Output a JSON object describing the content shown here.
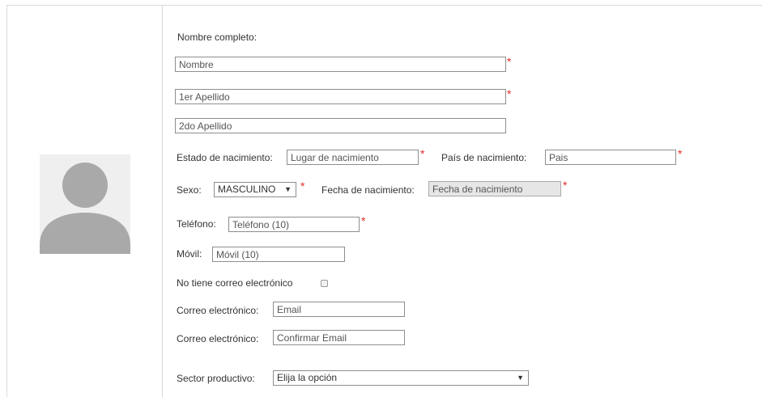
{
  "form": {
    "full_name_label": "Nombre completo:",
    "nombre_placeholder": "Nombre",
    "apellido1_placeholder": "1er Apellido",
    "apellido2_placeholder": "2do Apellido",
    "estado_label": "Estado de nacimiento:",
    "estado_placeholder": "Lugar de nacimiento",
    "pais_label": "País de nacimiento:",
    "pais_placeholder": "Pais",
    "sexo_label": "Sexo:",
    "sexo_value": "MASCULINO",
    "fecha_label": "Fecha de nacimiento:",
    "fecha_placeholder": "Fecha de nacimiento",
    "telefono_label": "Teléfono:",
    "telefono_placeholder": "Teléfono (10)",
    "movil_label": "Móvil:",
    "movil_placeholder": "Móvil (10)",
    "no_email_label": "No tiene correo electrónico",
    "no_email_checked": false,
    "email_label": "Correo electrónico:",
    "email_placeholder": "Email",
    "email_confirm_label": "Correo electrónico:",
    "email_confirm_placeholder": "Confirmar Email",
    "sector_label": "Sector productivo:",
    "sector_value": "Elija la opción",
    "required_mark": "*",
    "dropdown_arrow": "▼"
  },
  "icons": {
    "avatar": "user-silhouette-icon",
    "dropdown": "triangle-down-icon"
  },
  "colors": {
    "required": "#e32c2c",
    "border": "#8e8e8e",
    "disabled_bg": "#e6e6e6",
    "avatar_bg": "#efefef",
    "avatar_fg": "#a9a9a9"
  }
}
